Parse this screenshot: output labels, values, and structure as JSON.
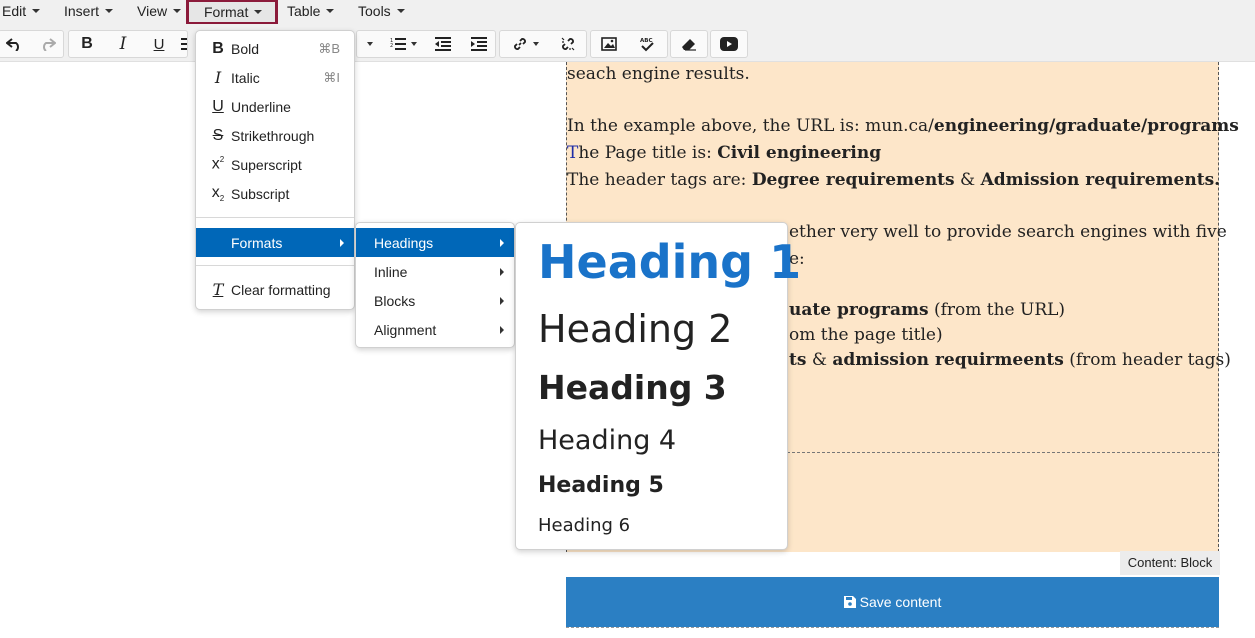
{
  "menubar": {
    "items": [
      {
        "label": "Edit"
      },
      {
        "label": "Insert"
      },
      {
        "label": "View"
      },
      {
        "label": "Format"
      },
      {
        "label": "Table"
      },
      {
        "label": "Tools"
      }
    ]
  },
  "toolbar": {
    "buttons": [
      "undo-icon",
      "redo-icon",
      "bold-icon",
      "italic-icon",
      "underline-icon",
      "align-icon",
      "bullet-list-icon",
      "numbered-list-icon",
      "outdent-icon",
      "indent-icon",
      "link-icon",
      "unlink-icon",
      "image-icon",
      "spellcheck-icon",
      "eraser-icon",
      "youtube-icon"
    ]
  },
  "format_menu": {
    "items": [
      {
        "label": "Bold",
        "shortcut": "⌘B"
      },
      {
        "label": "Italic",
        "shortcut": "⌘I"
      },
      {
        "label": "Underline"
      },
      {
        "label": "Strikethrough"
      },
      {
        "label": "Superscript"
      },
      {
        "label": "Subscript"
      },
      {
        "label": "Formats"
      },
      {
        "label": "Clear formatting"
      }
    ]
  },
  "formats_menu": {
    "items": [
      {
        "label": "Headings"
      },
      {
        "label": "Inline"
      },
      {
        "label": "Blocks"
      },
      {
        "label": "Alignment"
      }
    ]
  },
  "headings_menu": {
    "items": [
      {
        "label": "Heading 1"
      },
      {
        "label": "Heading 2"
      },
      {
        "label": "Heading 3"
      },
      {
        "label": "Heading 4"
      },
      {
        "label": "Heading 5"
      },
      {
        "label": "Heading 6"
      }
    ],
    "accent": "#1a73c9"
  },
  "content": {
    "line1": "seach engine results.",
    "line2_prefix": "In the example above, the URL is: mun.ca/",
    "line2_bold": "engineering/graduate/programs",
    "line3_cursor": "T",
    "line3_prefix": "he Page title is: ",
    "line3_bold": "Civil engineering",
    "line4_prefix": "The header tags are: ",
    "line4_bold1": "Degree requirements",
    "line4_mid": " & ",
    "line4_bold2": "Admission requirements.",
    "line5": "ether very well to provide search engines with five",
    "line6": "e:",
    "line7_bold": "uate programs",
    "line7_rest": " (from the URL)",
    "line8": "om the page title)",
    "line9_bold1": "ts",
    "line9_mid": " & ",
    "line9_bold2": "admission requirmeents",
    "line9_rest": " (from header tags)"
  },
  "content_label": "Content: Block",
  "save_button": "Save content",
  "colors": {
    "content_bg": "#fde6c9",
    "save_bg": "#2b7fc3",
    "selected_menu": "#0067b8",
    "active_menu_border": "#8b1a3a"
  }
}
